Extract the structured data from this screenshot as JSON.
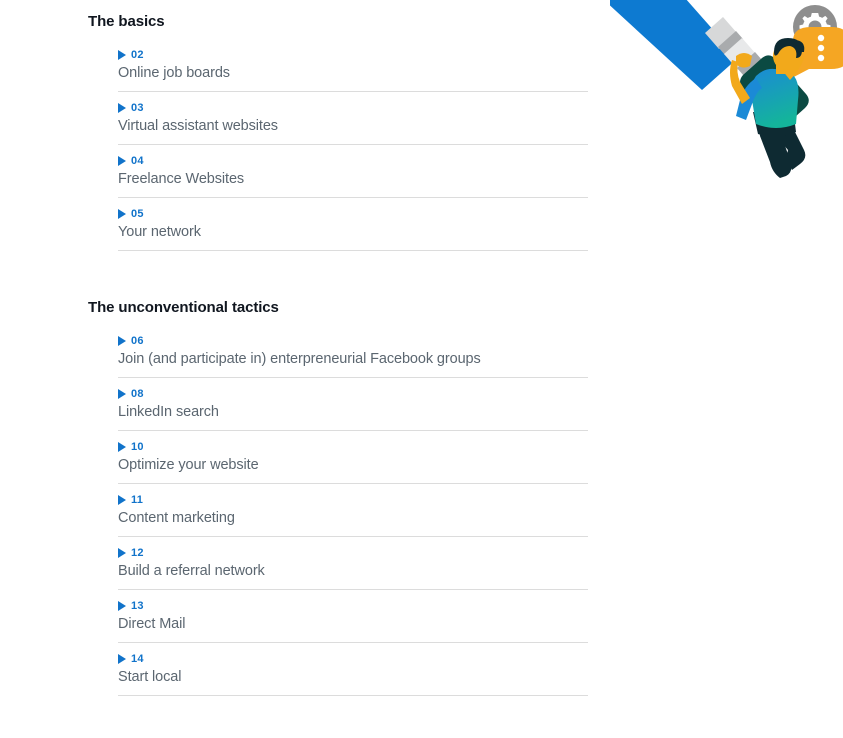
{
  "page": {
    "background_color": "#ffffff",
    "accent_blue": "#1173ca",
    "heading_color": "#10161f",
    "item_text_color": "#5b6670",
    "divider_color": "#dcdcdc"
  },
  "illustration": {
    "name": "person-hanging-from-pencil-illustration",
    "elements": [
      {
        "name": "pencil-body",
        "color": "#0d7ad1"
      },
      {
        "name": "pencil-ferrule",
        "color": "#c9cacb"
      },
      {
        "name": "pencil-eraser",
        "color": "#0b4a42"
      },
      {
        "name": "person-shirt",
        "color": "#1b8ad6"
      },
      {
        "name": "person-shirt-gradient-end",
        "color": "#14b49b"
      },
      {
        "name": "person-pants",
        "color": "#0e2a32"
      },
      {
        "name": "person-hair",
        "color": "#0e2a32"
      },
      {
        "name": "person-skin",
        "color": "#f2a91b"
      },
      {
        "name": "gear-icon",
        "color": "#8e8e8e"
      },
      {
        "name": "speech-bubble",
        "color": "#f5a623"
      },
      {
        "name": "speech-bubble-dots",
        "color": "#ffffff"
      }
    ]
  },
  "sections": [
    {
      "heading": "The basics",
      "items": [
        {
          "number": "02",
          "title": "Online job boards"
        },
        {
          "number": "03",
          "title": "Virtual assistant websites"
        },
        {
          "number": "04",
          "title": "Freelance Websites"
        },
        {
          "number": "05",
          "title": "Your network"
        }
      ]
    },
    {
      "heading": "The unconventional tactics",
      "items": [
        {
          "number": "06",
          "title": "Join (and participate in) enterpreneurial Facebook groups"
        },
        {
          "number": "08",
          "title": "LinkedIn search"
        },
        {
          "number": "10",
          "title": "Optimize your website"
        },
        {
          "number": "11",
          "title": "Content marketing"
        },
        {
          "number": "12",
          "title": "Build a referral network"
        },
        {
          "number": "13",
          "title": "Direct Mail"
        },
        {
          "number": "14",
          "title": "Start local"
        }
      ]
    }
  ]
}
